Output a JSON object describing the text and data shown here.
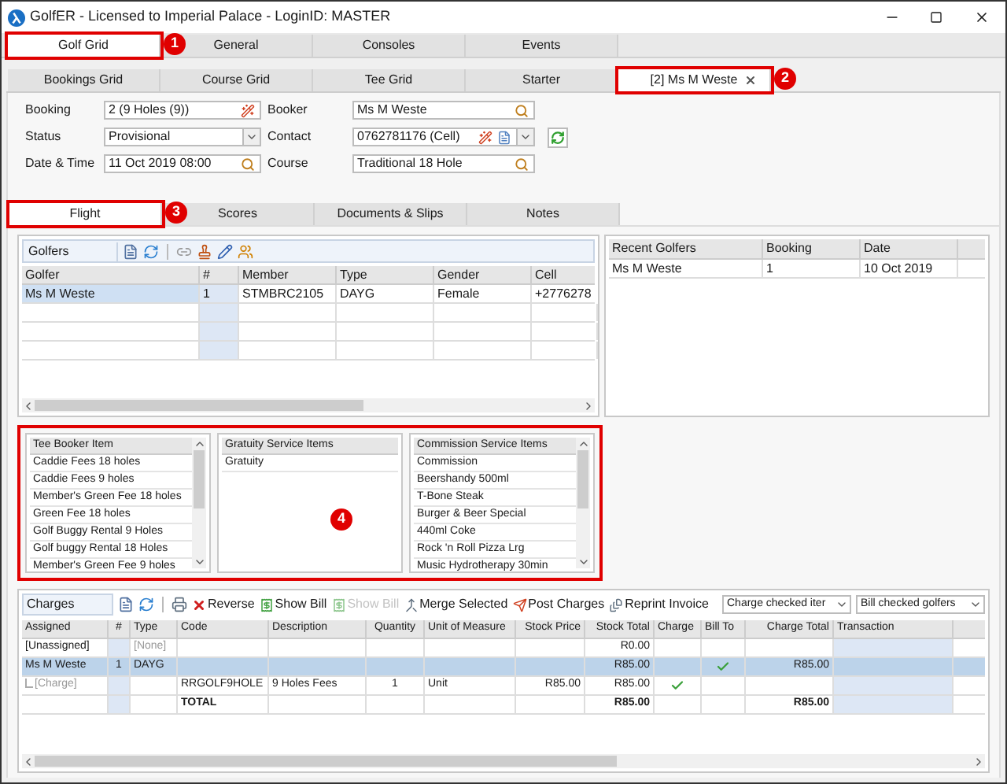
{
  "window": {
    "title": "GolfER - Licensed to Imperial Palace - LoginID: MASTER"
  },
  "main_tabs": [
    {
      "label": "Golf Grid",
      "selected": true,
      "callout": "1"
    },
    {
      "label": "General",
      "selected": false
    },
    {
      "label": "Consoles",
      "selected": false
    },
    {
      "label": "Events",
      "selected": false
    }
  ],
  "booking_tabs": [
    {
      "label": "Bookings Grid",
      "selected": false
    },
    {
      "label": "Course Grid",
      "selected": false
    },
    {
      "label": "Tee Grid",
      "selected": false
    },
    {
      "label": "Starter",
      "selected": false
    },
    {
      "label": "[2] Ms M Weste",
      "selected": true,
      "closable": true,
      "callout": "2"
    }
  ],
  "booking_form": {
    "fields": [
      {
        "label": "Booking",
        "value": "2 (9 Holes (9))",
        "buttons": [
          {
            "kind": "wand"
          }
        ]
      },
      {
        "label": "Booker",
        "value": "Ms M Weste",
        "buttons": [
          {
            "kind": "search"
          }
        ]
      },
      {
        "label": "Status",
        "value": "Provisional",
        "buttons": [
          {
            "kind": "dropdown"
          }
        ]
      },
      {
        "label": "Contact",
        "value": "0762781176 (Cell)",
        "buttons": [
          {
            "kind": "wand"
          },
          {
            "kind": "document"
          },
          {
            "kind": "dropdown"
          }
        ]
      },
      {
        "label": "Date & Time",
        "value": "11 Oct 2019 08:00",
        "buttons": [
          {
            "kind": "search"
          }
        ]
      },
      {
        "label": "Course",
        "value": "Traditional 18 Hole",
        "buttons": [
          {
            "kind": "search"
          }
        ]
      }
    ]
  },
  "detail_tabs": [
    {
      "label": "Flight",
      "selected": true,
      "callout": "3"
    },
    {
      "label": "Scores",
      "selected": false
    },
    {
      "label": "Documents & Slips",
      "selected": false
    },
    {
      "label": "Notes",
      "selected": false
    }
  ],
  "golfers": {
    "title": "Golfers",
    "toolbar": [
      {
        "kind": "new"
      },
      {
        "kind": "refresh"
      },
      {
        "kind": "separator"
      },
      {
        "kind": "link"
      },
      {
        "kind": "stamp"
      },
      {
        "kind": "edit"
      },
      {
        "kind": "people"
      }
    ],
    "columns": [
      "Golfer",
      "#",
      "Member",
      "Type",
      "Gender",
      "Cell"
    ],
    "rows": [
      {
        "cells": [
          "Ms M Weste",
          "1",
          "STMBRC2105",
          "DAYG",
          "Female",
          "+2776278"
        ],
        "selected": true
      }
    ]
  },
  "recent_golfers": {
    "columns": [
      "Recent Golfers",
      "Booking",
      "Date"
    ],
    "rows": [
      [
        "Ms M Weste",
        "1",
        "10 Oct 2019"
      ]
    ]
  },
  "service_items": {
    "callout": "4",
    "lists": [
      {
        "header": "Tee Booker Item",
        "scrollbar": true,
        "items": [
          "Caddie Fees 18 holes",
          "Caddie Fees 9 holes",
          "Member's Green Fee 18 holes",
          "Green Fee 18 holes",
          "Golf Buggy Rental 9 Holes",
          "Golf buggy Rental 18 Holes",
          "Member's Green Fee 9 holes"
        ]
      },
      {
        "header": "Gratuity Service Items",
        "scrollbar": false,
        "items": [
          "Gratuity"
        ]
      },
      {
        "header": "Commission Service Items",
        "scrollbar": true,
        "items": [
          "Commission",
          "Beershandy 500ml",
          "T-Bone Steak",
          "Burger & Beer Special",
          "440ml Coke",
          "Rock 'n Roll Pizza Lrg",
          "Music Hydrotherapy 30min"
        ]
      }
    ]
  },
  "charges": {
    "title": "Charges",
    "toolbar": [
      {
        "kind": "new"
      },
      {
        "kind": "refresh"
      },
      {
        "kind": "separator"
      },
      {
        "kind": "print"
      },
      {
        "kind": "reverse",
        "label": "Reverse",
        "disabled": false
      },
      {
        "kind": "show-bill",
        "label": "Show Bill",
        "disabled": false
      },
      {
        "kind": "show-bill",
        "label": "Show Bill",
        "disabled": true
      },
      {
        "kind": "merge",
        "label": "Merge Selected",
        "disabled": false
      },
      {
        "kind": "post",
        "label": "Post Charges",
        "disabled": false
      },
      {
        "kind": "reprint",
        "label": "Reprint Invoice",
        "disabled": false
      }
    ],
    "dropdowns": [
      "Charge checked iter",
      "Bill checked golfers"
    ],
    "columns": [
      "Assigned",
      "#",
      "Type",
      "Code",
      "Description",
      "Quantity",
      "Unit of Measure",
      "Stock Price",
      "Stock Total",
      "Charge",
      "Bill To",
      "Charge Total",
      "Transaction"
    ],
    "rows": [
      {
        "kind": "unassigned",
        "assigned": "[Unassigned]",
        "type": "[None]",
        "stock_total": "R0.00",
        "charged": false,
        "billed": false,
        "selected": false
      },
      {
        "kind": "golfer",
        "assigned": "Ms M Weste",
        "number": "1",
        "type": "DAYG",
        "stock_total": "R85.00",
        "charge_total": "R85.00",
        "charged": false,
        "billed": true,
        "selected": true
      },
      {
        "kind": "charge",
        "assigned": "[Charge]",
        "code": "RRGOLF9HOLE",
        "description": "9 Holes Fees",
        "quantity": "1",
        "unit": "Unit",
        "stock_price": "R85.00",
        "stock_total": "R85.00",
        "charged": true,
        "billed": false,
        "selected": false
      },
      {
        "kind": "total",
        "code": "TOTAL",
        "stock_total": "R85.00",
        "charge_total": "R85.00",
        "charged": false,
        "billed": false,
        "selected": false
      }
    ]
  }
}
